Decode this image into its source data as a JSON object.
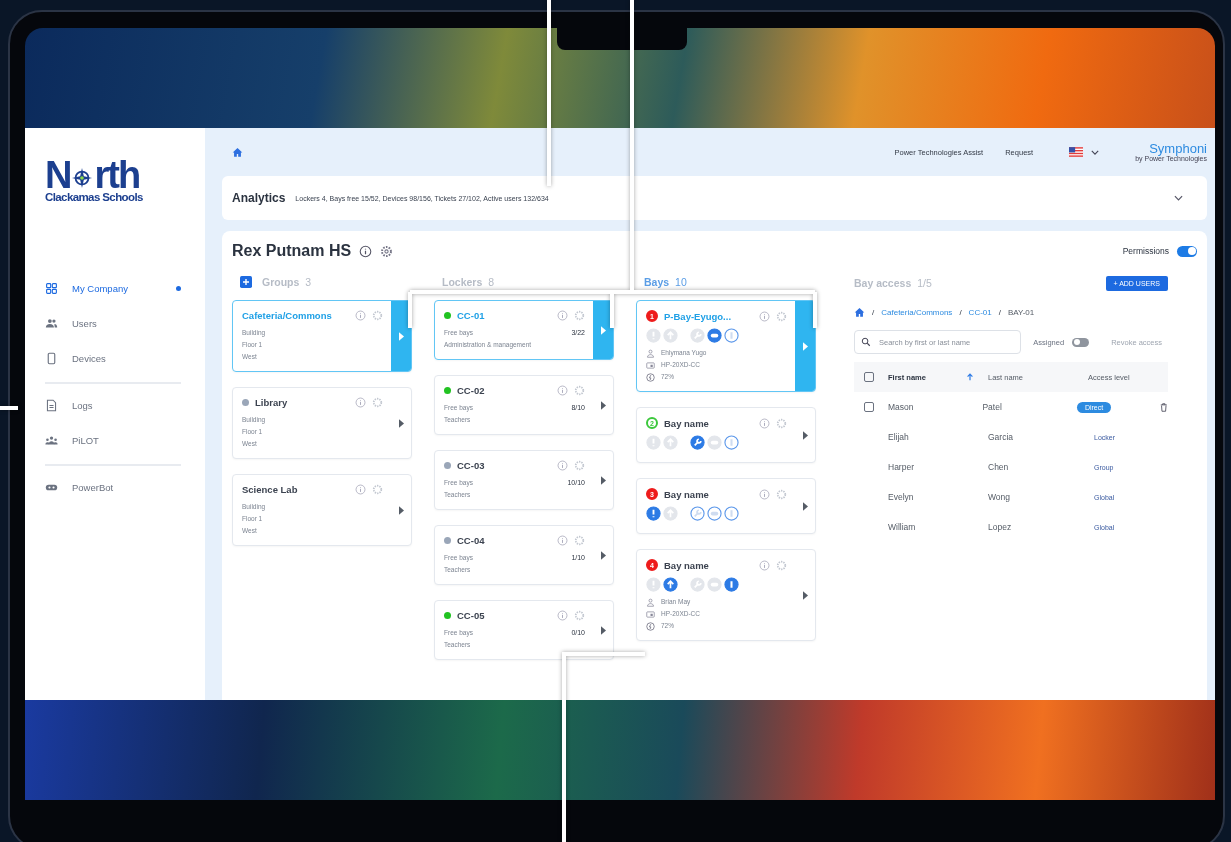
{
  "logo": {
    "lead": "N",
    "tail": "rth",
    "subtitle": "Clackamas Schools"
  },
  "sidebar": {
    "sections": [
      [
        {
          "label": "My Company",
          "selected": true
        },
        {
          "label": "Users",
          "selected": false
        },
        {
          "label": "Devices",
          "selected": false
        }
      ],
      [
        {
          "label": "Logs",
          "selected": false
        },
        {
          "label": "PiLOT",
          "selected": false
        }
      ],
      [
        {
          "label": "PowerBot",
          "selected": false
        }
      ]
    ]
  },
  "topbar": {
    "links": [
      "Power Technologies Assist",
      "Request"
    ],
    "brand": "Symphoni",
    "brand_sub": "by Power Technologies"
  },
  "analytics": {
    "title": "Analytics",
    "summary": "Lockers 4, Bays free 15/52, Devices 98/156, Tickets 27/102, Active users 132/634"
  },
  "site": {
    "title": "Rex Putnam HS",
    "permissions_label": "Permissions",
    "permissions_on": true
  },
  "groups": {
    "title": "Groups",
    "count": "3",
    "items": [
      {
        "name": "Cafeteria/Commons",
        "lines": [
          "Building",
          "Floor 1",
          "West"
        ],
        "selected": true
      },
      {
        "name": "Library",
        "color": "#9aa6b8",
        "lines": [
          "Building",
          "Floor 1",
          "West"
        ],
        "selected": false
      },
      {
        "name": "Science Lab",
        "lines": [
          "Building",
          "Floor 1",
          "West"
        ],
        "selected": false
      }
    ]
  },
  "lockers": {
    "title": "Lockers",
    "count": "8",
    "items": [
      {
        "name": "CC-01",
        "color": "#22c322",
        "label": "Free bays",
        "value": "3/22",
        "note": "Administration & management",
        "selected": true
      },
      {
        "name": "CC-02",
        "color": "#22c322",
        "label": "Free bays",
        "value": "8/10",
        "note": "Teachers",
        "selected": false
      },
      {
        "name": "CC-03",
        "color": "#9aa6b8",
        "label": "Free bays",
        "value": "10/10",
        "note": "Teachers",
        "selected": false
      },
      {
        "name": "CC-04",
        "color": "#9aa6b8",
        "label": "Free bays",
        "value": "1/10",
        "note": "Teachers",
        "selected": false
      },
      {
        "name": "CC-05",
        "color": "#22c322",
        "label": "Free bays",
        "value": "0/10",
        "note": "Teachers",
        "selected": false
      }
    ]
  },
  "bays": {
    "title": "Bays",
    "count": "10",
    "items": [
      {
        "number": "1",
        "color": "#ee1c1c",
        "kind": "solid",
        "name": "P-Bay-Eyugo...",
        "selected": true,
        "status": [
          {
            "kind": "alert",
            "enabled": false,
            "on": false
          },
          {
            "kind": "arrow",
            "enabled": false,
            "on": false
          },
          {
            "kind": "wrench",
            "enabled": false,
            "on": false
          },
          {
            "kind": "chat",
            "enabled": true,
            "on": true
          },
          {
            "kind": "person",
            "enabled": true,
            "on": false
          }
        ],
        "user": "Ehlymana Yugo",
        "device": "HP-20XD-CC",
        "battery": "72%"
      },
      {
        "number": "2",
        "color": "#3cc83c",
        "kind": "ring",
        "name": "Bay name",
        "selected": false,
        "status": [
          {
            "kind": "alert",
            "enabled": false,
            "on": false
          },
          {
            "kind": "arrow",
            "enabled": false,
            "on": false
          },
          {
            "kind": "wrench",
            "enabled": true,
            "on": true
          },
          {
            "kind": "chat",
            "enabled": false,
            "on": false
          },
          {
            "kind": "person",
            "enabled": true,
            "on": false
          }
        ]
      },
      {
        "number": "3",
        "color": "#ee1c1c",
        "kind": "solid",
        "name": "Bay name",
        "selected": false,
        "status": [
          {
            "kind": "alert",
            "enabled": true,
            "on": true
          },
          {
            "kind": "arrow",
            "enabled": false,
            "on": false
          },
          {
            "kind": "wrench",
            "enabled": true,
            "on": false
          },
          {
            "kind": "chat",
            "enabled": true,
            "on": false
          },
          {
            "kind": "person",
            "enabled": true,
            "on": false
          }
        ]
      },
      {
        "number": "4",
        "color": "#ee1c1c",
        "kind": "solid",
        "name": "Bay name",
        "selected": false,
        "status": [
          {
            "kind": "alert",
            "enabled": false,
            "on": false
          },
          {
            "kind": "arrow",
            "enabled": true,
            "on": true
          },
          {
            "kind": "wrench",
            "enabled": false,
            "on": false
          },
          {
            "kind": "chat",
            "enabled": false,
            "on": false
          },
          {
            "kind": "person",
            "enabled": true,
            "on": true
          }
        ],
        "user": "Brian May",
        "device": "HP-20XD-CC",
        "battery": "72%"
      }
    ]
  },
  "access": {
    "title": "Bay access",
    "count": "1/5",
    "add_button": "+ ADD USERS",
    "breadcrumb": [
      {
        "sep": "/",
        "label": "Cafeteria/Commons"
      },
      {
        "sep": "/",
        "label": "CC-01"
      },
      {
        "sep": "/",
        "label": "BAY-01"
      }
    ],
    "search": {
      "placeholder": "Search by first or last name"
    },
    "assigned": {
      "label": "Assigned",
      "on": false
    },
    "revoke": {
      "label": "Revoke access",
      "disabled": true
    },
    "columns": [
      {
        "label": "First name",
        "sorted": true
      },
      {
        "label": "Last name",
        "sorted": false
      },
      {
        "label": "Access level",
        "sorted": false
      }
    ],
    "header_checked": false,
    "rows": [
      {
        "first": "Mason",
        "last": "Patel",
        "level": "Direct",
        "kind": "pill",
        "checked": false,
        "deletable": true
      },
      {
        "first": "Elijah",
        "last": "Garcia",
        "level": "Locker",
        "kind": "plain"
      },
      {
        "first": "Harper",
        "last": "Chen",
        "level": "Group",
        "kind": "plain"
      },
      {
        "first": "Evelyn",
        "last": "Wong",
        "level": "Global",
        "kind": "plain"
      },
      {
        "first": "William",
        "last": "Lopez",
        "level": "Global",
        "kind": "plain"
      }
    ]
  }
}
